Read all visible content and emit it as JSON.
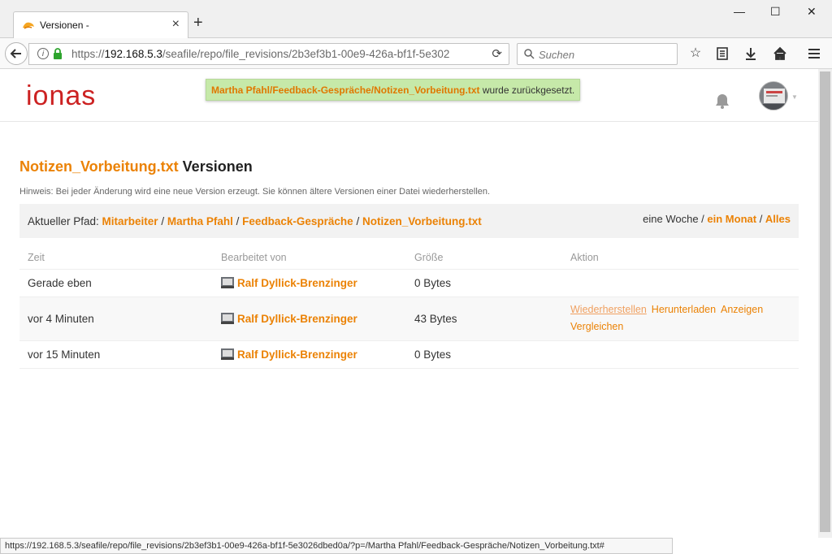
{
  "browser": {
    "tab_title": "Versionen -",
    "tab_close": "×",
    "new_tab": "+",
    "window_controls": {
      "minimize": "—",
      "maximize": "☐",
      "close": "✕"
    },
    "url_prefix": "https://",
    "url_host": "192.168.5.3",
    "url_path": "/seafile/repo/file_revisions/2b3ef3b1-00e9-426a-bf1f-5e302",
    "search_placeholder": "Suchen",
    "status_url": "https://192.168.5.3/seafile/repo/file_revisions/2b3ef3b1-00e9-426a-bf1f-5e3026dbed0a/?p=/Martha Pfahl/Feedback-Gespräche/Notizen_Vorbeitung.txt#"
  },
  "header": {
    "logo": "ionas",
    "notice_path": "Martha Pfahl/Feedback-Gespräche/Notizen_Vorbeitung.txt",
    "notice_msg": " wurde zurückgesetzt."
  },
  "page": {
    "file_name": "Notizen_Vorbeitung.txt",
    "title_suffix": " Versionen",
    "hint": "Hinweis: Bei jeder Änderung wird eine neue Version erzeugt. Sie können ältere Versionen einer Datei wiederherstellen."
  },
  "path_bar": {
    "label": "Aktueller Pfad: ",
    "crumbs": [
      "Mitarbeiter",
      "Martha Pfahl",
      "Feedback-Gespräche",
      "Notizen_Vorbeitung.txt"
    ],
    "separator": " / ",
    "range_week": "eine Woche",
    "range_month": "ein Monat",
    "range_all": "Alles"
  },
  "table": {
    "headers": [
      "Zeit",
      "Bearbeitet von",
      "Größe",
      "Aktion"
    ],
    "rows": [
      {
        "time": "Gerade eben",
        "author": "Ralf Dyllick-Brenzinger",
        "size": "0 Bytes"
      },
      {
        "time": "vor 4 Minuten",
        "author": "Ralf Dyllick-Brenzinger",
        "size": "43 Bytes",
        "actions": [
          "Wiederherstellen",
          "Herunterladen",
          "Anzeigen",
          "Vergleichen"
        ]
      },
      {
        "time": "vor 15 Minuten",
        "author": "Ralf Dyllick-Brenzinger",
        "size": "0 Bytes"
      }
    ]
  }
}
